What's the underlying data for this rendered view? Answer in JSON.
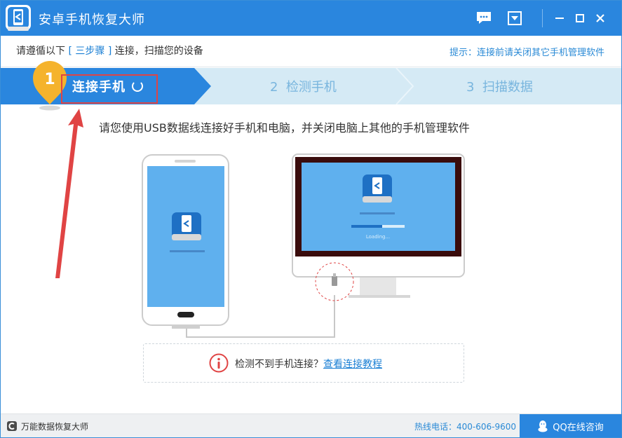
{
  "app": {
    "title": "安卓手机恢复大师"
  },
  "hint": {
    "prefix": "请遵循以下",
    "steps_label": "[ 三步骤 ]",
    "suffix": "连接，扫描您的设备",
    "tip": "提示：连接前请关闭其它手机管理软件"
  },
  "steps": [
    {
      "number": "1",
      "label": "连接手机",
      "active": true
    },
    {
      "number": "2",
      "label": "检测手机",
      "active": false
    },
    {
      "number": "3",
      "label": "扫描数据",
      "active": false
    }
  ],
  "instruction": "请您使用USB数据线连接好手机和电脑，并关闭电脑上其他的手机管理软件",
  "monitor": {
    "loading_text": "Loading..."
  },
  "error": {
    "text": "检测不到手机连接？",
    "link": "查看连接教程"
  },
  "footer": {
    "left_label": "万能数据恢复大师",
    "hotline": "热线电话：400-606-9600",
    "qq_label": "QQ在线咨询"
  },
  "colors": {
    "primary": "#2a86de",
    "highlight": "#e04444",
    "badge": "#f5b32c"
  }
}
